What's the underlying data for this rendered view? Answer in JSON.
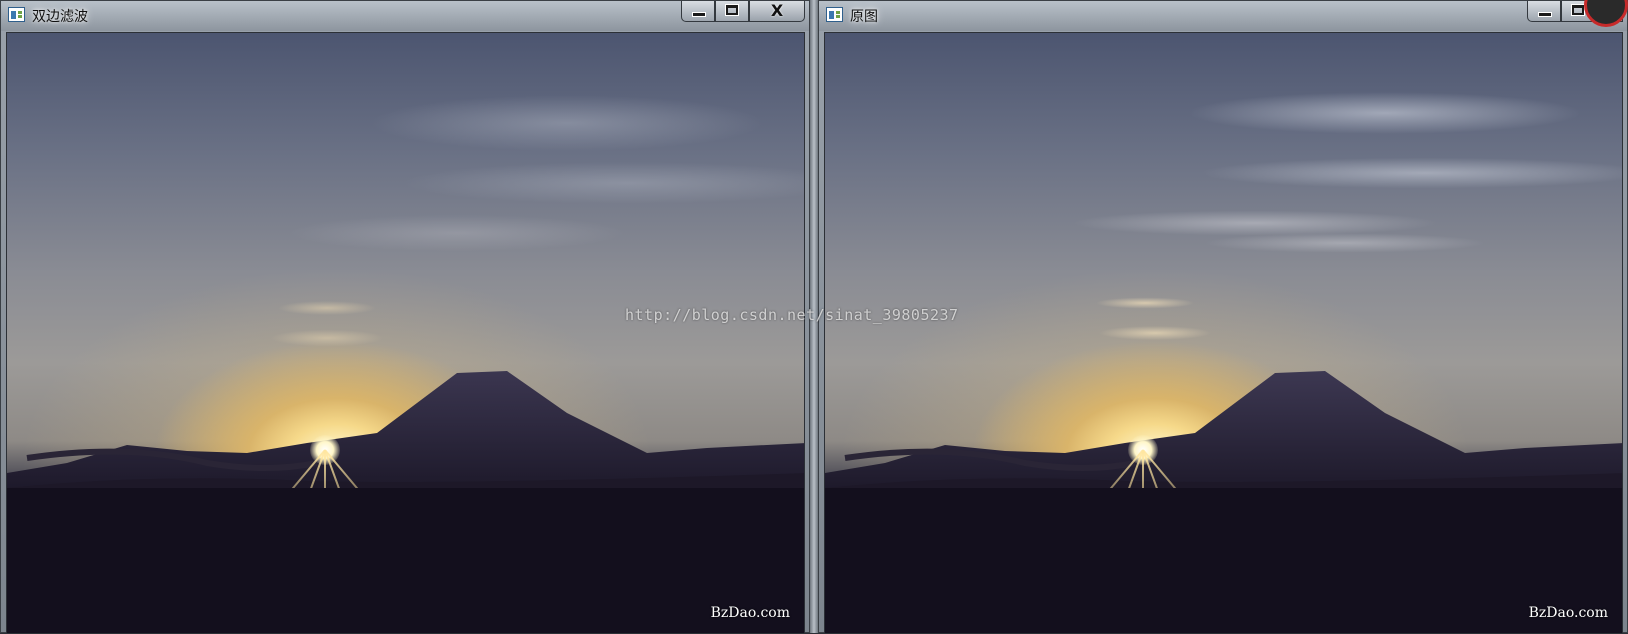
{
  "windows": [
    {
      "title": "双边滤波",
      "icon": "opencv-window-icon",
      "controls": {
        "minimize": "minimize",
        "maximize": "maximize",
        "close": "X"
      },
      "watermark": "BzDao.com"
    },
    {
      "title": "原图",
      "icon": "opencv-window-icon",
      "controls": {
        "minimize": "minimize",
        "maximize": "maximize"
      },
      "watermark": "BzDao.com"
    }
  ],
  "overlay_watermark": "http://blog.csdn.net/sinat_39805237",
  "colors": {
    "sky_top": "#4c5570",
    "sun_glow": "#f6d98a",
    "ground": "#130f1d",
    "close_badge": "#c72a2a"
  }
}
